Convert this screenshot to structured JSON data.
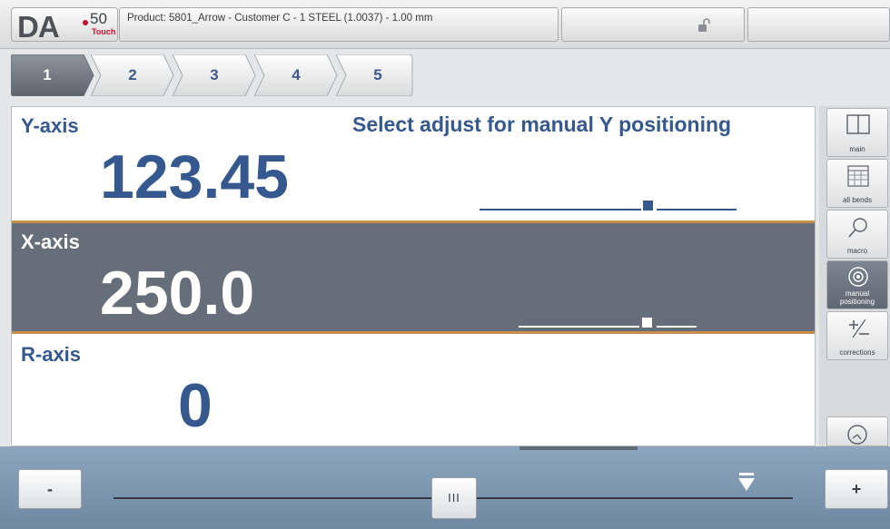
{
  "header": {
    "logo_text": "DA",
    "logo_model": "50",
    "logo_sub": "Touch",
    "product_info": "Product: 5801_Arrow - Customer C - 1 STEEL (1.0037) - 1.00 mm",
    "lock_icon": "unlocked-padlock-icon"
  },
  "steps": [
    {
      "label": "1",
      "active": true
    },
    {
      "label": "2",
      "active": false
    },
    {
      "label": "3",
      "active": false
    },
    {
      "label": "4",
      "active": false
    },
    {
      "label": "5",
      "active": false
    }
  ],
  "axes": {
    "y": {
      "label": "Y-axis",
      "value": "123.45",
      "hint": "Select adjust for manual Y positioning"
    },
    "x": {
      "label": "X-axis",
      "value": "250.0"
    },
    "r": {
      "label": "R-axis",
      "value": "0"
    }
  },
  "side_menu": [
    {
      "icon": "main-panel-icon",
      "label": "main",
      "selected": false
    },
    {
      "icon": "all-bends-grid-icon",
      "label": "all bends",
      "selected": false
    },
    {
      "icon": "magnifier-icon",
      "label": "macro",
      "selected": false
    },
    {
      "icon": "manual-positioning-icon",
      "label": "manual positioning",
      "selected": true
    },
    {
      "icon": "plus-minus-icon",
      "label": "corrections",
      "selected": false
    }
  ],
  "side_bottom_icon": "clock-icon",
  "slider": {
    "minus_label": "-",
    "plus_label": "+",
    "thumb_label": "III"
  },
  "colors": {
    "accent_blue": "#35588f",
    "selected_row": "#666f79",
    "row_border": "#c8904e",
    "bottom_bar": "#7d95ae"
  }
}
